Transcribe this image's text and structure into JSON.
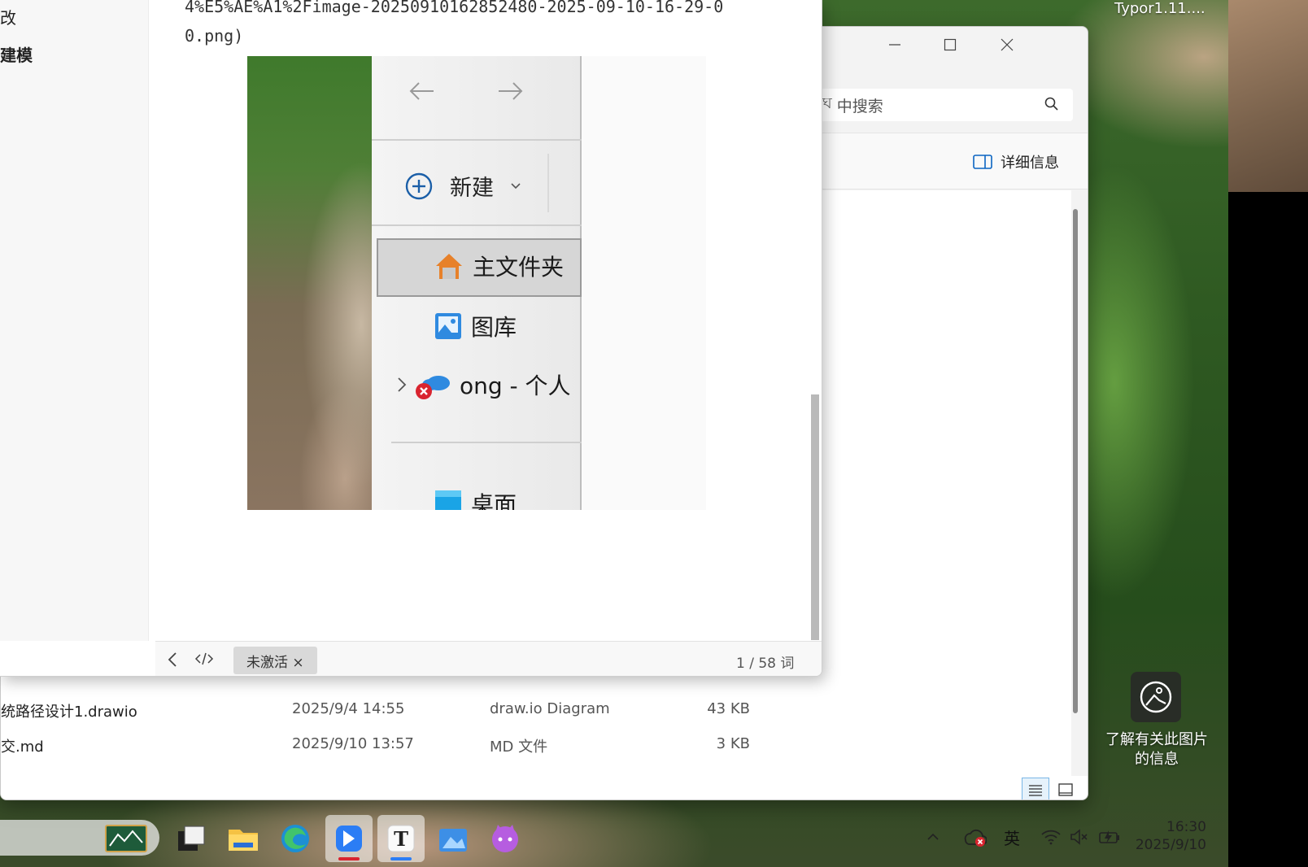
{
  "desktop": {
    "typora_task_label": "Typor1.11....",
    "spotlight_label": "了解有关此图片的信息"
  },
  "explorer": {
    "search_placeholder": "中搜索",
    "search_prefix": "ঘ",
    "details_label": "详细信息",
    "files": [
      {
        "name": "统路径设计1.drawio",
        "date": "2025/9/4 14:55",
        "type": "draw.io Diagram",
        "size": "43 KB"
      },
      {
        "name": "交.md",
        "date": "2025/9/10 13:57",
        "type": "MD 文件",
        "size": "3 KB"
      }
    ]
  },
  "typora": {
    "sidebar": [
      "改",
      "建模"
    ],
    "markdown_lines": [
      "4%E5%AE%A1%2Fimage-20250910162852480-2025-09-10-16-29-0",
      "0.png)"
    ],
    "embedded_image": {
      "new_label": "新建",
      "nav_items": [
        "主文件夹",
        "图库",
        "ong - 个人",
        "桌面"
      ]
    },
    "status": {
      "badge": "未激活 ×",
      "word_count": "1 / 58 词"
    }
  },
  "taskbar": {
    "apps": [
      "sketch-app",
      "task-view",
      "file-explorer",
      "edge",
      "feishu",
      "typora",
      "photos",
      "cat-app"
    ],
    "tray_lang": "英",
    "clock_time": "16:30",
    "clock_date": "2025/9/10"
  }
}
